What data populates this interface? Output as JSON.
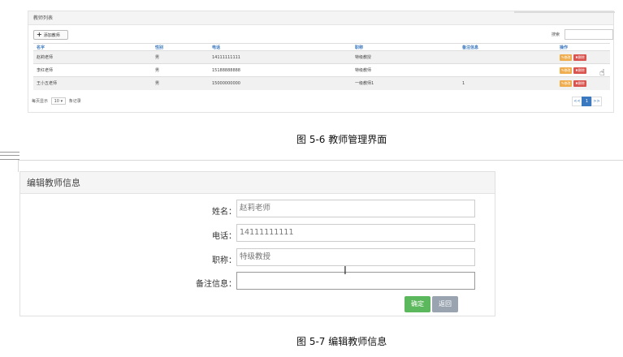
{
  "figure1": {
    "panel_title": "教师列表",
    "add_button_label": "添加教师",
    "search_label": "搜索",
    "columns": [
      "名字",
      "性别",
      "电话",
      "职称",
      "备注信息",
      "操作"
    ],
    "rows": [
      {
        "name": "赵莉老师",
        "gender": "男",
        "phone": "14111111111",
        "title": "特级教授",
        "note": ""
      },
      {
        "name": "李红老师",
        "gender": "男",
        "phone": "15188888888",
        "title": "特级教师",
        "note": ""
      },
      {
        "name": "王小五老师",
        "gender": "男",
        "phone": "15000000000",
        "title": "一级教师1",
        "note": "1"
      }
    ],
    "actions": {
      "edit": "修改",
      "delete": "删除"
    },
    "page_size_prefix": "每页显示",
    "page_size": "10",
    "page_size_suffix": "条记录",
    "pager": {
      "prev": "<<",
      "current": "1",
      "next": ">>"
    }
  },
  "caption1": "图 5-6  教师管理界面",
  "figure2": {
    "panel_title": "编辑教师信息",
    "fields": [
      {
        "label": "姓名：",
        "value": "赵莉老师"
      },
      {
        "label": "电话：",
        "value": "14111111111"
      },
      {
        "label": "职称：",
        "value": "特级教授"
      },
      {
        "label": "备注信息：",
        "value": ""
      }
    ],
    "ok_label": "确定",
    "back_label": "返回"
  },
  "caption2": "图 5-7  编辑教师信息",
  "colors": {
    "link_blue": "#3a78c0",
    "edit_orange": "#f0ad4e",
    "delete_red": "#d9534f",
    "ok_green": "#5cb85c",
    "back_gray": "#99a4b0"
  }
}
